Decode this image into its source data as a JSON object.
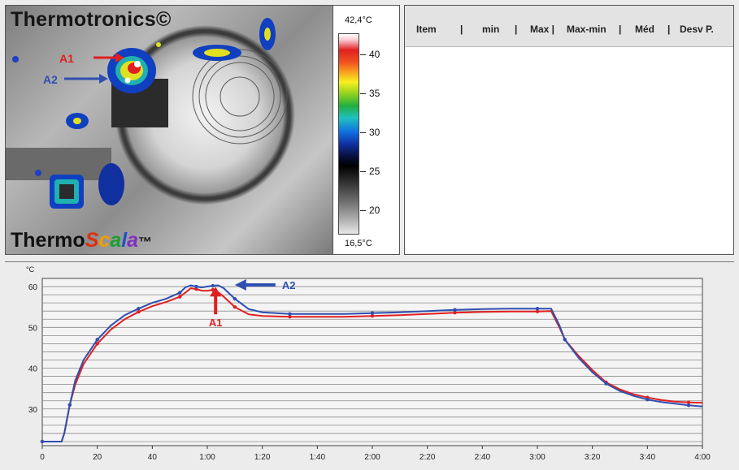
{
  "thermal": {
    "brand_top": "Thermotronics©",
    "brand_bottom": [
      "Thermo",
      "S",
      "c",
      "a",
      "l",
      "a",
      "™"
    ],
    "brand_bottom_colors": [
      "#111111",
      "#e03010",
      "#f0a000",
      "#18a030",
      "#2050d0",
      "#8030c0",
      "#111111"
    ],
    "marker_a1": "A1",
    "marker_a2": "A2",
    "marker_a1_color": "#e02020",
    "marker_a2_color": "#2f4fb0"
  },
  "scale": {
    "max_label": "42,4°C",
    "min_label": "16,5°C",
    "ticks": [
      "40",
      "35",
      "30",
      "25",
      "20"
    ]
  },
  "stats": {
    "columns": [
      "Item",
      "|",
      "min",
      "|",
      "Max |",
      "Max-min",
      "|",
      "Méd",
      "|",
      "Desv P."
    ]
  },
  "chart_data": {
    "type": "line",
    "ylabel": "°C",
    "xticks": [
      "0",
      "20",
      "40",
      "1:00",
      "1:20",
      "1:40",
      "2:00",
      "2:20",
      "2:40",
      "3:00",
      "3:20",
      "3:40",
      "4:00"
    ],
    "yticks": [
      "30",
      "40",
      "50",
      "60"
    ],
    "xlim": [
      0,
      240
    ],
    "ylim": [
      21,
      62
    ],
    "annotations": [
      {
        "text": "A2",
        "x": 70,
        "y": 60,
        "color": "#2f4fb0"
      },
      {
        "text": "A1",
        "x": 63,
        "y": 54,
        "color": "#e02020"
      }
    ],
    "series": [
      {
        "name": "A1",
        "color": "#e02020",
        "x": [
          0,
          7,
          8,
          10,
          12,
          15,
          20,
          25,
          30,
          35,
          40,
          45,
          50,
          52,
          54,
          56,
          58,
          60,
          62,
          64,
          66,
          70,
          75,
          80,
          90,
          100,
          110,
          120,
          130,
          140,
          150,
          160,
          170,
          180,
          185,
          188,
          190,
          195,
          200,
          205,
          210,
          215,
          220,
          225,
          230,
          235,
          240
        ],
        "y": [
          22,
          22,
          24,
          31,
          36,
          41,
          46,
          49.5,
          52,
          53.8,
          55.2,
          56.2,
          57.5,
          58.5,
          59.6,
          59.4,
          59,
          59,
          59.2,
          58.6,
          57.5,
          55,
          53.2,
          52.8,
          52.6,
          52.6,
          52.6,
          52.8,
          53,
          53.3,
          53.6,
          53.8,
          53.9,
          53.9,
          54,
          50,
          47,
          43,
          39.5,
          36.5,
          34.8,
          33.6,
          32.8,
          32.2,
          31.8,
          31.6,
          31.5
        ]
      },
      {
        "name": "A2",
        "color": "#2f4fb0",
        "x": [
          0,
          7,
          8,
          10,
          12,
          15,
          20,
          25,
          30,
          35,
          40,
          45,
          50,
          52,
          54,
          56,
          58,
          60,
          62,
          64,
          66,
          70,
          75,
          80,
          90,
          100,
          110,
          120,
          130,
          140,
          150,
          160,
          170,
          180,
          185,
          188,
          190,
          195,
          200,
          205,
          210,
          215,
          220,
          225,
          230,
          235,
          240
        ],
        "y": [
          22,
          22,
          24,
          31,
          37,
          42,
          47,
          50.5,
          53,
          54.6,
          56,
          57,
          58.5,
          59.8,
          60.3,
          60,
          59.8,
          60,
          60.2,
          60.3,
          59.6,
          57,
          54.5,
          53.7,
          53.3,
          53.3,
          53.3,
          53.5,
          53.7,
          54,
          54.3,
          54.5,
          54.6,
          54.6,
          54.6,
          50.5,
          47,
          42.5,
          39,
          36.2,
          34.4,
          33.2,
          32.3,
          31.7,
          31.3,
          30.9,
          30.6
        ]
      }
    ]
  }
}
